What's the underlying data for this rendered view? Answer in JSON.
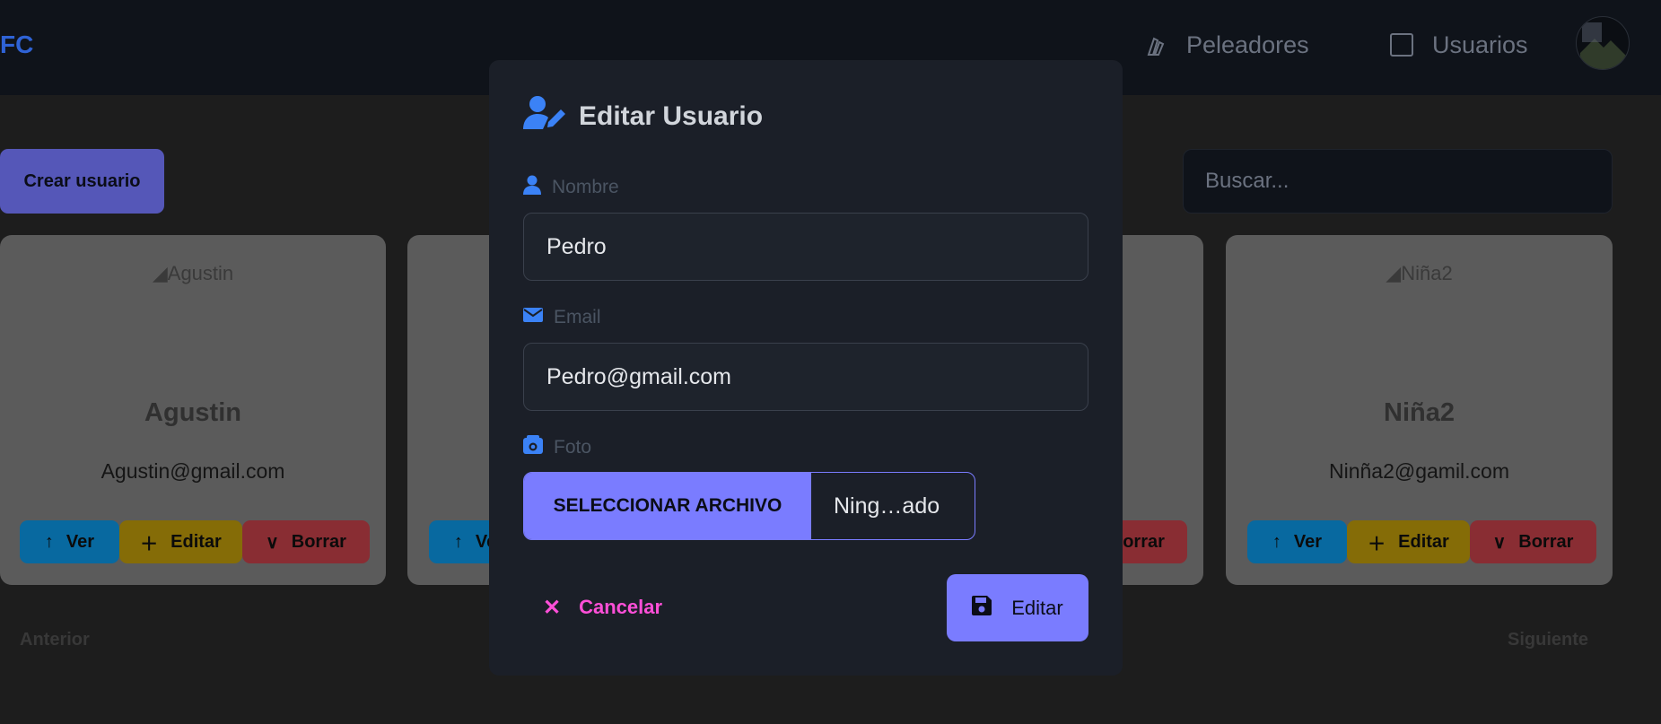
{
  "navbar": {
    "brand": "FC",
    "items": [
      {
        "label": "Peleadores",
        "icon": "fist-icon"
      },
      {
        "label": "Usuarios",
        "icon": "checkbox-icon"
      }
    ]
  },
  "toolbar": {
    "create_label": "Crear usuario",
    "search_placeholder": "Buscar..."
  },
  "cards": [
    {
      "img_alt": "Agustin",
      "name": "Agustin",
      "email": "Agustin@gmail.com"
    },
    {
      "img_alt": "",
      "name": "",
      "email": ""
    },
    {
      "img_alt": "",
      "name": "",
      "email": ""
    },
    {
      "img_alt": "Niña2",
      "name": "Niña2",
      "email": "Ninña2@gamil.com"
    }
  ],
  "card_buttons": {
    "ver": "Ver",
    "editar": "Editar",
    "borrar": "Borrar"
  },
  "pagination": {
    "prev": "Anterior",
    "next": "Siguiente"
  },
  "modal": {
    "title": "Editar Usuario",
    "name_label": "Nombre",
    "name_value": "Pedro",
    "email_label": "Email",
    "email_value": "Pedro@gmail.com",
    "photo_label": "Foto",
    "file_button": "SELECCIONAR ARCHIVO",
    "file_status": "Ning…ado",
    "cancel_label": "Cancelar",
    "submit_label": "Editar"
  },
  "colors": {
    "accent": "#7a7cff",
    "icon_blue": "#3b82f6",
    "cancel_pink": "#ff4fd8",
    "ver": "#0869a0",
    "editar": "#856c07",
    "borrar": "#892d33"
  }
}
